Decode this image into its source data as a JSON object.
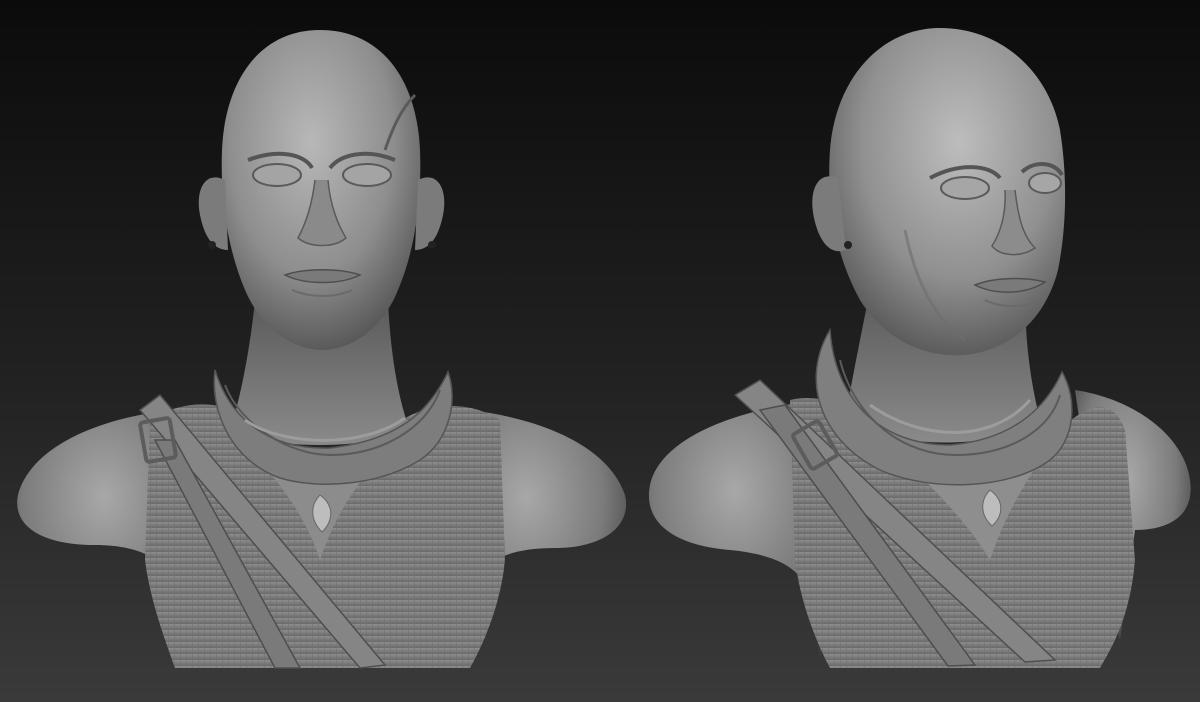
{
  "scene": {
    "background_top": "#0b0b0b",
    "background_bottom": "#3a3a3a",
    "clay_light": "#b4b4b4",
    "clay_mid": "#8a8a8a",
    "clay_dark": "#4a4a4a",
    "views": [
      {
        "name": "front-view",
        "subject": "bust-sculpture"
      },
      {
        "name": "three-quarter-view",
        "subject": "bust-sculpture"
      }
    ]
  }
}
